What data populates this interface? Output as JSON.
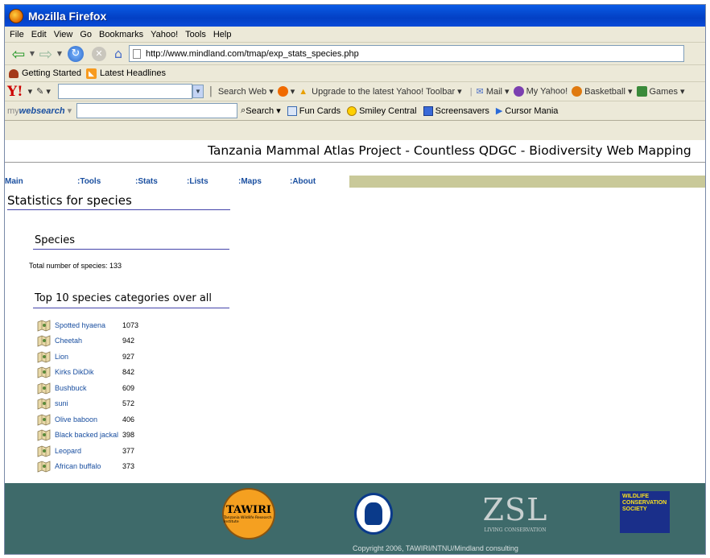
{
  "window": {
    "title": "Mozilla Firefox"
  },
  "menubar": {
    "items": [
      "File",
      "Edit",
      "View",
      "Go",
      "Bookmarks",
      "Yahoo!",
      "Tools",
      "Help"
    ]
  },
  "navbar": {
    "url": "http://www.mindland.com/tmap/exp_stats_species.php"
  },
  "bookmarks": {
    "items": [
      "Getting Started",
      "Latest Headlines"
    ]
  },
  "yahoo_toolbar": {
    "search_label": "Search Web",
    "upgrade_label": "Upgrade to the latest Yahoo! Toolbar",
    "mail_label": "Mail",
    "myyahoo_label": "My Yahoo!",
    "basketball_label": "Basketball",
    "games_label": "Games"
  },
  "websearch_toolbar": {
    "logo_prefix": "my",
    "logo_bold": "websearch",
    "search_label": "Search",
    "funcards_label": "Fun Cards",
    "smiley_label": "Smiley Central",
    "screensavers_label": "Screensavers",
    "cursor_label": "Cursor Mania"
  },
  "page": {
    "site_title": "Tanzania Mammal Atlas Project - Countless QDGC - Biodiversity Web Mapping",
    "nav": [
      "Main",
      ":Tools",
      ":Stats",
      ":Lists",
      ":Maps",
      ":About"
    ],
    "heading": "Statistics for species",
    "species_heading": "Species",
    "total_text": "Total number of species: 133",
    "top10_heading": "Top 10 species categories over all",
    "top10": [
      {
        "name": "Spotted hyaena",
        "count": "1073"
      },
      {
        "name": "Cheetah",
        "count": "942"
      },
      {
        "name": "Lion",
        "count": "927"
      },
      {
        "name": "Kirks DikDik",
        "count": "842"
      },
      {
        "name": "Bushbuck",
        "count": "609"
      },
      {
        "name": "suni",
        "count": "572"
      },
      {
        "name": "Olive baboon",
        "count": "406"
      },
      {
        "name": "Black backed jackal",
        "count": "398"
      },
      {
        "name": "Leopard",
        "count": "377"
      },
      {
        "name": "African buffalo",
        "count": "373"
      }
    ]
  },
  "footer": {
    "tawiri_text": "TAWIRI",
    "tawiri_sub": "Tanzania Wildlife Research Institute",
    "zsl_text": "ZSL",
    "zsl_sub": "LIVING CONSERVATION",
    "wcs_text": "WILDLIFE CONSERVATION SOCIETY",
    "copyright": "Copyright 2006, TAWIRI/NTNU/Mindland consulting"
  }
}
